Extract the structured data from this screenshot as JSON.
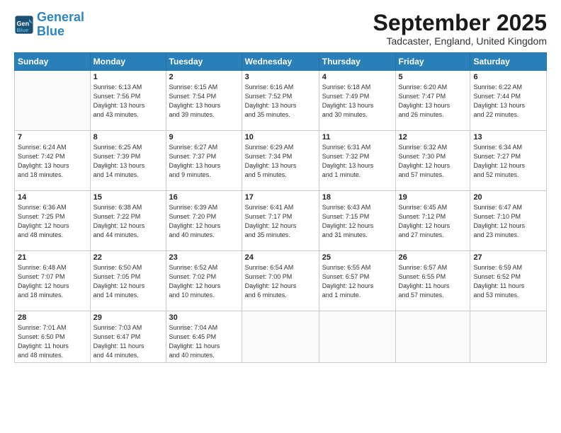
{
  "logo": {
    "line1": "General",
    "line2": "Blue"
  },
  "title": "September 2025",
  "location": "Tadcaster, England, United Kingdom",
  "days_header": [
    "Sunday",
    "Monday",
    "Tuesday",
    "Wednesday",
    "Thursday",
    "Friday",
    "Saturday"
  ],
  "weeks": [
    [
      {
        "num": "",
        "info": ""
      },
      {
        "num": "1",
        "info": "Sunrise: 6:13 AM\nSunset: 7:56 PM\nDaylight: 13 hours\nand 43 minutes."
      },
      {
        "num": "2",
        "info": "Sunrise: 6:15 AM\nSunset: 7:54 PM\nDaylight: 13 hours\nand 39 minutes."
      },
      {
        "num": "3",
        "info": "Sunrise: 6:16 AM\nSunset: 7:52 PM\nDaylight: 13 hours\nand 35 minutes."
      },
      {
        "num": "4",
        "info": "Sunrise: 6:18 AM\nSunset: 7:49 PM\nDaylight: 13 hours\nand 30 minutes."
      },
      {
        "num": "5",
        "info": "Sunrise: 6:20 AM\nSunset: 7:47 PM\nDaylight: 13 hours\nand 26 minutes."
      },
      {
        "num": "6",
        "info": "Sunrise: 6:22 AM\nSunset: 7:44 PM\nDaylight: 13 hours\nand 22 minutes."
      }
    ],
    [
      {
        "num": "7",
        "info": "Sunrise: 6:24 AM\nSunset: 7:42 PM\nDaylight: 13 hours\nand 18 minutes."
      },
      {
        "num": "8",
        "info": "Sunrise: 6:25 AM\nSunset: 7:39 PM\nDaylight: 13 hours\nand 14 minutes."
      },
      {
        "num": "9",
        "info": "Sunrise: 6:27 AM\nSunset: 7:37 PM\nDaylight: 13 hours\nand 9 minutes."
      },
      {
        "num": "10",
        "info": "Sunrise: 6:29 AM\nSunset: 7:34 PM\nDaylight: 13 hours\nand 5 minutes."
      },
      {
        "num": "11",
        "info": "Sunrise: 6:31 AM\nSunset: 7:32 PM\nDaylight: 13 hours\nand 1 minute."
      },
      {
        "num": "12",
        "info": "Sunrise: 6:32 AM\nSunset: 7:30 PM\nDaylight: 12 hours\nand 57 minutes."
      },
      {
        "num": "13",
        "info": "Sunrise: 6:34 AM\nSunset: 7:27 PM\nDaylight: 12 hours\nand 52 minutes."
      }
    ],
    [
      {
        "num": "14",
        "info": "Sunrise: 6:36 AM\nSunset: 7:25 PM\nDaylight: 12 hours\nand 48 minutes."
      },
      {
        "num": "15",
        "info": "Sunrise: 6:38 AM\nSunset: 7:22 PM\nDaylight: 12 hours\nand 44 minutes."
      },
      {
        "num": "16",
        "info": "Sunrise: 6:39 AM\nSunset: 7:20 PM\nDaylight: 12 hours\nand 40 minutes."
      },
      {
        "num": "17",
        "info": "Sunrise: 6:41 AM\nSunset: 7:17 PM\nDaylight: 12 hours\nand 35 minutes."
      },
      {
        "num": "18",
        "info": "Sunrise: 6:43 AM\nSunset: 7:15 PM\nDaylight: 12 hours\nand 31 minutes."
      },
      {
        "num": "19",
        "info": "Sunrise: 6:45 AM\nSunset: 7:12 PM\nDaylight: 12 hours\nand 27 minutes."
      },
      {
        "num": "20",
        "info": "Sunrise: 6:47 AM\nSunset: 7:10 PM\nDaylight: 12 hours\nand 23 minutes."
      }
    ],
    [
      {
        "num": "21",
        "info": "Sunrise: 6:48 AM\nSunset: 7:07 PM\nDaylight: 12 hours\nand 18 minutes."
      },
      {
        "num": "22",
        "info": "Sunrise: 6:50 AM\nSunset: 7:05 PM\nDaylight: 12 hours\nand 14 minutes."
      },
      {
        "num": "23",
        "info": "Sunrise: 6:52 AM\nSunset: 7:02 PM\nDaylight: 12 hours\nand 10 minutes."
      },
      {
        "num": "24",
        "info": "Sunrise: 6:54 AM\nSunset: 7:00 PM\nDaylight: 12 hours\nand 6 minutes."
      },
      {
        "num": "25",
        "info": "Sunrise: 6:55 AM\nSunset: 6:57 PM\nDaylight: 12 hours\nand 1 minute."
      },
      {
        "num": "26",
        "info": "Sunrise: 6:57 AM\nSunset: 6:55 PM\nDaylight: 11 hours\nand 57 minutes."
      },
      {
        "num": "27",
        "info": "Sunrise: 6:59 AM\nSunset: 6:52 PM\nDaylight: 11 hours\nand 53 minutes."
      }
    ],
    [
      {
        "num": "28",
        "info": "Sunrise: 7:01 AM\nSunset: 6:50 PM\nDaylight: 11 hours\nand 48 minutes."
      },
      {
        "num": "29",
        "info": "Sunrise: 7:03 AM\nSunset: 6:47 PM\nDaylight: 11 hours\nand 44 minutes."
      },
      {
        "num": "30",
        "info": "Sunrise: 7:04 AM\nSunset: 6:45 PM\nDaylight: 11 hours\nand 40 minutes."
      },
      {
        "num": "",
        "info": ""
      },
      {
        "num": "",
        "info": ""
      },
      {
        "num": "",
        "info": ""
      },
      {
        "num": "",
        "info": ""
      }
    ]
  ]
}
